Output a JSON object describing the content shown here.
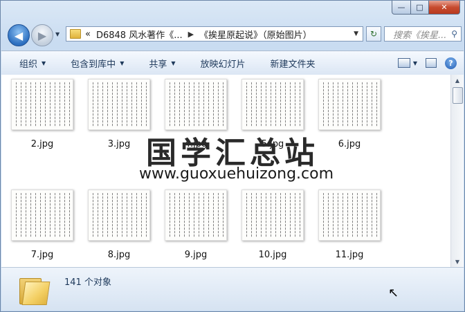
{
  "window": {
    "caption": {
      "minimize": "—",
      "maximize": "□",
      "close": "✕"
    }
  },
  "nav": {
    "back_icon": "arrow-left-icon",
    "forward_icon": "arrow-right-icon",
    "dropdown": "▼"
  },
  "address": {
    "prefix": "«",
    "segment1": "D6848 风水著作《...",
    "separator": "▶",
    "segment2": "《挨星原起说》（原始图片）",
    "chevron": "▼"
  },
  "refresh_symbol": "↻",
  "search": {
    "placeholder": "搜索《挨星...",
    "icon": "🔍"
  },
  "toolbar": {
    "organize": "组织",
    "include_library": "包含到库中",
    "share": "共享",
    "slideshow": "放映幻灯片",
    "new_folder": "新建文件夹",
    "arrow": "▼",
    "help": "?"
  },
  "files": [
    {
      "name": "2.jpg"
    },
    {
      "name": "3.jpg"
    },
    {
      "name": "4.jpg"
    },
    {
      "name": "5.jpg"
    },
    {
      "name": "6.jpg"
    },
    {
      "name": "7.jpg"
    },
    {
      "name": "8.jpg"
    },
    {
      "name": "9.jpg"
    },
    {
      "name": "10.jpg"
    },
    {
      "name": "11.jpg"
    }
  ],
  "watermark": {
    "title": "国学汇总站",
    "url": "www.guoxuehuizong.com"
  },
  "details": {
    "count": "141 个对象"
  },
  "scrollbar": {
    "up": "▲",
    "down": "▼"
  }
}
